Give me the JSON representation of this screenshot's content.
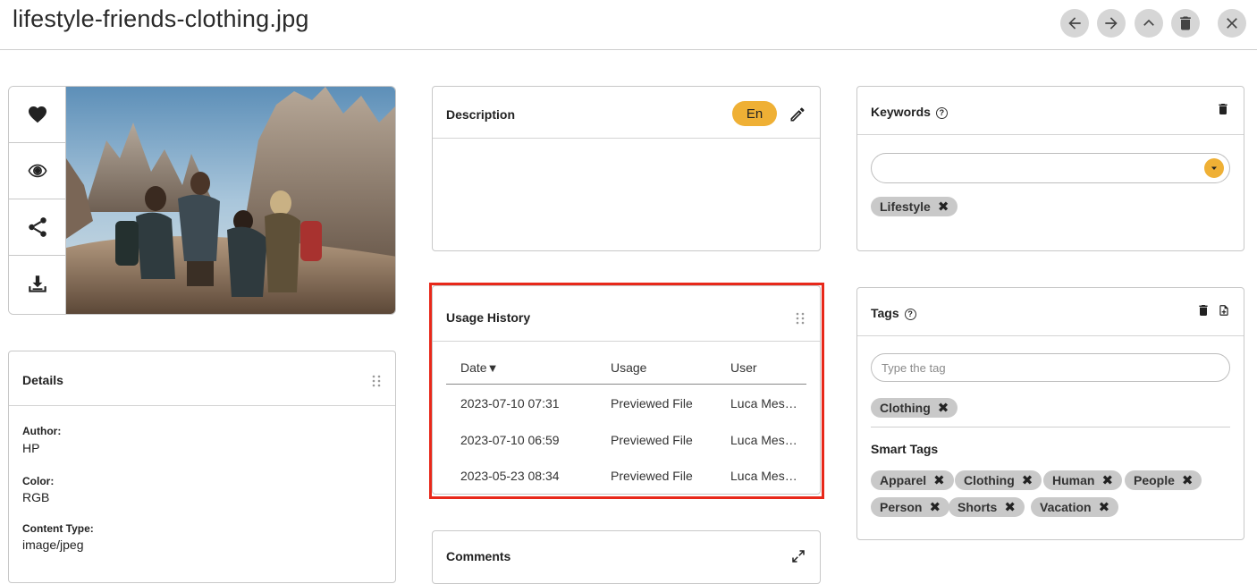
{
  "header": {
    "title": "lifestyle-friends-clothing.jpg",
    "buttons": [
      "arrow-left-icon",
      "arrow-right-icon",
      "chevron-up-icon",
      "trash-icon",
      "close-icon"
    ]
  },
  "image_panel": {
    "actions": [
      "heart-icon",
      "eye-icon",
      "share-icon",
      "download-icon"
    ]
  },
  "details": {
    "title": "Details",
    "fields": [
      {
        "label": "Author:",
        "value": "HP"
      },
      {
        "label": "Color:",
        "value": "RGB"
      },
      {
        "label": "Content Type:",
        "value": "image/jpeg"
      }
    ]
  },
  "description": {
    "title": "Description",
    "language": "En",
    "text": ""
  },
  "usage_history": {
    "title": "Usage History",
    "columns": [
      "Date",
      "Usage",
      "User"
    ],
    "rows": [
      {
        "date": "2023-07-10 07:31",
        "usage": "Previewed File",
        "user": "Luca Mes…"
      },
      {
        "date": "2023-07-10 06:59",
        "usage": "Previewed File",
        "user": "Luca Mes…"
      },
      {
        "date": "2023-05-23 08:34",
        "usage": "Previewed File",
        "user": "Luca Mes…"
      }
    ]
  },
  "comments": {
    "title": "Comments"
  },
  "keywords": {
    "title": "Keywords",
    "input_value": "",
    "chips": [
      "Lifestyle"
    ]
  },
  "tags": {
    "title": "Tags",
    "placeholder": "Type the tag",
    "chips": [
      "Clothing"
    ],
    "smart_tags_title": "Smart Tags",
    "smart_tags": [
      "Apparel",
      "Clothing",
      "Human",
      "People",
      "Person",
      "Shorts",
      "Vacation"
    ]
  },
  "colors": {
    "accent": "#efb035",
    "highlight": "#e8281a",
    "chip": "#c9c9c9"
  }
}
